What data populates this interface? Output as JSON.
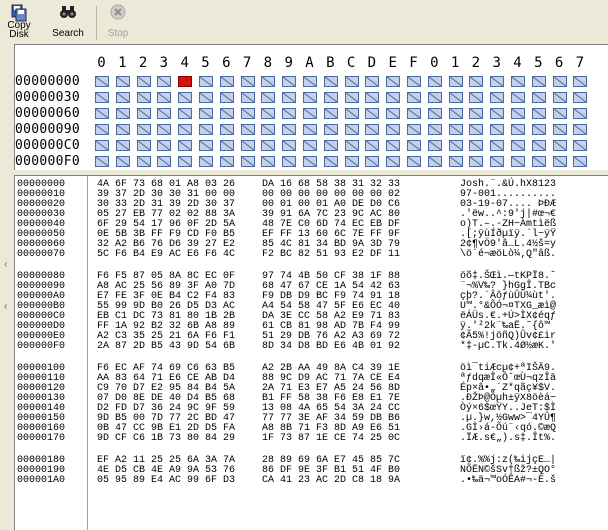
{
  "toolbar": {
    "buttons": [
      {
        "label": "Copy\nDisk",
        "icon": "copy-disk-icon",
        "enabled": true
      },
      {
        "label": "Search",
        "icon": "binoculars-icon",
        "enabled": true
      },
      {
        "label": "Stop",
        "icon": "stop-icon",
        "enabled": false
      }
    ]
  },
  "map": {
    "columns": [
      "0",
      "1",
      "2",
      "3",
      "4",
      "5",
      "6",
      "7",
      "8",
      "9",
      "A",
      "B",
      "C",
      "D",
      "E",
      "F",
      "0",
      "1",
      "2",
      "3",
      "4",
      "5",
      "6",
      "7"
    ],
    "rows": [
      {
        "address": "00000000",
        "selected_index": 4
      },
      {
        "address": "00000030",
        "selected_index": null
      },
      {
        "address": "00000060",
        "selected_index": null
      },
      {
        "address": "00000090",
        "selected_index": null
      },
      {
        "address": "000000C0",
        "selected_index": null
      },
      {
        "address": "000000F0",
        "selected_index": null
      }
    ],
    "colors": {
      "cell_fill": "#c4d2e8",
      "cell_border": "#4a6aa0",
      "selected": "#d81010"
    }
  },
  "hex": {
    "blocks": [
      [
        {
          "addr": "00000000",
          "b1": "4A 6F 73 68 01 A8 03 26",
          "b2": "DA 16 68 58 38 31 32 33",
          "ascii": "Josh.¨.&Ú.hX8123"
        },
        {
          "addr": "00000010",
          "b1": "39 37 2D 30 30 31 00 00",
          "b2": "00 00 00 00 00 00 00 02",
          "ascii": "97-001.........."
        },
        {
          "addr": "00000020",
          "b1": "30 33 2D 31 39 2D 30 37",
          "b2": "00 01 00 01 A0 DE D0 C6",
          "ascii": "03-19-07.... ÞÐÆ"
        },
        {
          "addr": "00000030",
          "b1": "05 27 EB 77 02 02 88 3A",
          "b2": "39 91 6A 7C 23 9C AC 80",
          "ascii": ".'ëw..^:9'j|#œ¬€"
        },
        {
          "addr": "00000040",
          "b1": "6F 29 54 17 96 0F 2D 5A",
          "b2": "48 7E C0 6D 74 EC EB DF",
          "ascii": "o)T.–.-ZH~Àmtìëß"
        },
        {
          "addr": "00000050",
          "b1": "0E 5B 3B FF F9 CD F0 B5",
          "b2": "EF FF 13 60 6C 7E FF 9F",
          "ascii": ".[;ÿùÍðµïÿ.`l~ÿŸ"
        },
        {
          "addr": "00000060",
          "b1": "32 A2 B6 76 D6 39 27 E2",
          "b2": "85 4C 81 34 BD 9A 3D 79",
          "ascii": "2¢¶vÖ9'â…L.4½š=y"
        },
        {
          "addr": "00000070",
          "b1": "5C F6 B4 E9 AC E6 F6 4C",
          "b2": "F2 BC 82 51 93 E2 DF 11",
          "ascii": "\\ö´é¬æöLò¼‚Q\"âß."
        }
      ],
      [
        {
          "addr": "00000080",
          "b1": "F6 F5 87 05 8A 8C EC 0F",
          "b2": "97 74 4B 50 CF 38 1F 88",
          "ascii": "öõ‡.ŠŒì.—tKPÏ8.ˆ"
        },
        {
          "addr": "00000090",
          "b1": "A8 AC 25 56 89 3F A0 7D",
          "b2": "68 47 67 CE 1A 54 42 63",
          "ascii": "¨¬%V‰? }hGgÎ.TBc"
        },
        {
          "addr": "000000A0",
          "b1": "E7 FE 3F 0E B4 C2 F4 83",
          "b2": "F9 DB D9 BC F9 74 91 18",
          "ascii": "çþ?.´ÂôƒùÛÙ¼ùt'."
        },
        {
          "addr": "000000B0",
          "b1": "55 99 9D B0 26 D5 D3 AC",
          "b2": "A4 54 58 47 5F E6 EC 40",
          "ascii": "U™.°&ÕÓ¬¤TXG_æì@"
        },
        {
          "addr": "000000C0",
          "b1": "EB C1 DC 73 81 80 1B 2B",
          "b2": "DA 3E CC 58 A2 E9 71 83",
          "ascii": "ëÁÜs.€.+Ú>ÌX¢éqƒ"
        },
        {
          "addr": "000000D0",
          "b1": "FF 1A 92 B2 32 6B A8 89",
          "b2": "61 CB 81 98 AD 7B F4 99",
          "ascii": "ÿ.'²2k¨‰aË.˜­{ô™"
        },
        {
          "addr": "000000E0",
          "b1": "A2 C3 35 25 21 6A F6 F1",
          "b2": "51 29 DB 76 A2 A3 69 72",
          "ascii": "¢Ã5%!jöñQ)Ûv¢£ir"
        },
        {
          "addr": "000000F0",
          "b1": "2A 87 2D B5 43 9D 54 6B",
          "b2": "8D 34 D8 BD E6 4B 01 92",
          "ascii": "*‡-µC.Tk.4Ø½æK.'"
        }
      ],
      [
        {
          "addr": "00000100",
          "b1": "F6 EC AF 74 69 C6 63 B5",
          "b2": "A2 2B AA 49 8A C4 39 1E",
          "ascii": "öì¯tiÆcµ¢+ªIŠÄ9."
        },
        {
          "addr": "00000110",
          "b1": "AA 83 64 71 E6 CE AB D4",
          "b2": "88 9C D9 AC 71 7A CE E4",
          "ascii": "ªƒdqæÎ«ÔˆœÙ¬qzÎä"
        },
        {
          "addr": "00000120",
          "b1": "C9 70 D7 E2 95 84 B4 5A",
          "b2": "2A 71 E3 E7 A5 24 56 8D",
          "ascii": "Ép×â•„´Z*qãç¥$V."
        },
        {
          "addr": "00000130",
          "b1": "07 D0 8E DE 40 D4 B5 68",
          "b2": "B1 FF 58 38 F6 E8 E1 7E",
          "ascii": ".ÐŽÞ@Ôµh±ÿX8öèá~"
        },
        {
          "addr": "00000140",
          "b1": "D2 FD D7 36 24 9C 9F 59",
          "b2": "13 08 4A 65 54 3A 24 CC",
          "ascii": "Òý×6$œŸY..JeT:$Ì"
        },
        {
          "addr": "00000150",
          "b1": "9D B5 00 7D 77 2C BD 47",
          "b2": "77 77 3E AF 34 59 DB B6",
          "ascii": ".µ.}w,½Gww>¯4YÛ¶"
        },
        {
          "addr": "00000160",
          "b1": "0B 47 CC 9B E1 2D D5 FA",
          "b2": "A8 8B 71 F3 8D A9 E6 51",
          "ascii": ".GÌ›á-Õú¨‹qó.©æQ"
        },
        {
          "addr": "00000170",
          "b1": "9D CF C6 1B 73 80 84 29",
          "b2": "1F 73 87 1E CE 74 25 0C",
          "ascii": ".ÏÆ.s€„).s‡.Ît%."
        }
      ],
      [
        {
          "addr": "00000180",
          "b1": "EF A2 11 25 25 6A 3A 7A",
          "b2": "28 89 69 6A E7 45 85 7C",
          "ascii": "ï¢.%%j:z(‰ijçE…|"
        },
        {
          "addr": "00000190",
          "b1": "4E D5 CB 4E A9 9A 53 76",
          "b2": "86 DF 9E 3F B1 51 4F B0",
          "ascii": "NÕËN©šSv†ßž?±QO°"
        },
        {
          "addr": "000001A0",
          "b1": "05 95 89 E4 AC 99 6F D3",
          "b2": "CA 41 23 AC 2D C8 18 9A",
          "ascii": ".•‰ä¬™oÓÊA#¬-È.š"
        }
      ]
    ]
  }
}
